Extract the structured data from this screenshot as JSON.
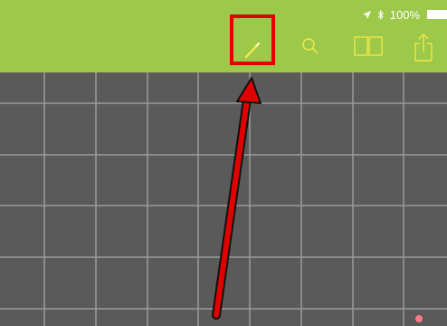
{
  "status_bar": {
    "battery_text": "100%",
    "icons": [
      "location-arrow-icon",
      "bluetooth-icon",
      "battery-icon"
    ]
  },
  "toolbar": {
    "accent_color": "#9cc94a",
    "icon_color": "#f2e64a",
    "buttons": [
      "pencil-icon",
      "search-icon",
      "book-icon",
      "share-icon"
    ]
  },
  "annotation": {
    "highlight_color": "#e10000",
    "highlighted_button": "edit-button"
  },
  "canvas": {
    "background_color": "#5a5a5a",
    "grid_color": "#9a9a9a"
  }
}
